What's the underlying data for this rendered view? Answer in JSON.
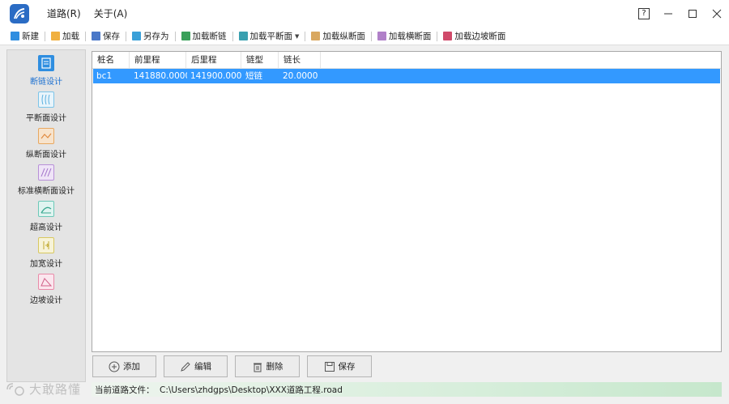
{
  "app": {
    "menu": [
      "道路(R)",
      "关于(A)"
    ]
  },
  "window_controls": {
    "help": "?"
  },
  "toolbar": {
    "items": [
      {
        "label": "新建",
        "icon": "new-file-icon",
        "color": "#2f8ee0"
      },
      {
        "label": "加载",
        "icon": "folder-icon",
        "color": "#f0b040"
      },
      {
        "label": "保存",
        "icon": "save-icon",
        "color": "#4a78c8"
      },
      {
        "label": "另存为",
        "icon": "save-as-icon",
        "color": "#3aa0d8"
      },
      {
        "label": "加载断链",
        "icon": "broken-chain-icon",
        "color": "#3aa05a"
      },
      {
        "label": "加载平断面",
        "icon": "plan-section-icon",
        "color": "#3aa0b0"
      },
      {
        "label": "加载纵断面",
        "icon": "profile-icon",
        "color": "#d9a860"
      },
      {
        "label": "加载横断面",
        "icon": "cross-section-icon",
        "color": "#b080c8"
      },
      {
        "label": "加载边坡断面",
        "icon": "slope-section-icon",
        "color": "#d04a6a"
      }
    ]
  },
  "sidebar": {
    "items": [
      {
        "label": "断链设计",
        "icon": "broken-chain-design-icon",
        "color": "#2f8ee0",
        "active": true
      },
      {
        "label": "平断面设计",
        "icon": "plan-design-icon",
        "color": "#7cc4e8"
      },
      {
        "label": "纵断面设计",
        "icon": "profile-design-icon",
        "color": "#e8a860"
      },
      {
        "label": "标准横断面设计",
        "icon": "cross-design-icon",
        "color": "#b890d8"
      },
      {
        "label": "超高设计",
        "icon": "superelevation-icon",
        "color": "#6cc8b8"
      },
      {
        "label": "加宽设计",
        "icon": "widening-icon",
        "color": "#d8c860"
      },
      {
        "label": "边坡设计",
        "icon": "slope-design-icon",
        "color": "#e88aa8"
      }
    ]
  },
  "table": {
    "columns": [
      "桩名",
      "前里程",
      "后里程",
      "链型",
      "链长"
    ],
    "rows": [
      [
        "bc1",
        "141880.0000",
        "141900.0000",
        "短链",
        "20.0000"
      ]
    ],
    "selected_row": 0
  },
  "actions": {
    "add": "添加",
    "edit": "编辑",
    "delete": "删除",
    "save": "保存"
  },
  "status": {
    "label": "当前道路文件：",
    "path": "C:\\Users\\zhdgps\\Desktop\\XXX道路工程.road"
  },
  "watermark": {
    "text": "大敢路懂"
  },
  "colors": {
    "selection": "#3399ff",
    "accent": "#1a6fd1"
  }
}
